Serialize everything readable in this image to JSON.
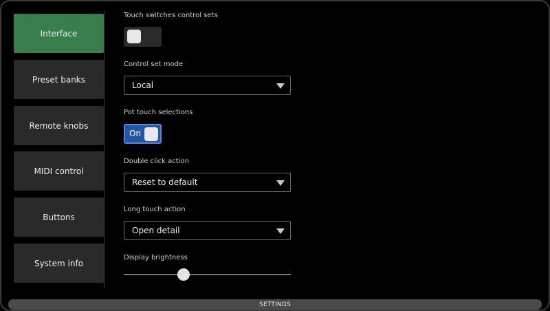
{
  "sidebar": {
    "items": [
      {
        "label": "Interface",
        "active": true
      },
      {
        "label": "Preset banks",
        "active": false
      },
      {
        "label": "Remote knobs",
        "active": false
      },
      {
        "label": "MIDI control",
        "active": false
      },
      {
        "label": "Buttons",
        "active": false
      },
      {
        "label": "System info",
        "active": false
      }
    ]
  },
  "settings": {
    "touch_switches": {
      "label": "Touch switches control sets",
      "state": "off"
    },
    "control_set_mode": {
      "label": "Control set mode",
      "value": "Local"
    },
    "pot_touch": {
      "label": "Pot touch selections",
      "state": "on",
      "on_text": "On"
    },
    "double_click": {
      "label": "Double click action",
      "value": "Reset to default"
    },
    "long_touch": {
      "label": "Long touch action",
      "value": "Open detail"
    },
    "brightness": {
      "label": "Display brightness",
      "value_fraction": 0.36
    }
  },
  "footer": {
    "label": "SETTINGS"
  },
  "colors": {
    "active_tab": "#3a7d4d",
    "toggle_on": "#2456a8",
    "background": "#000000"
  }
}
